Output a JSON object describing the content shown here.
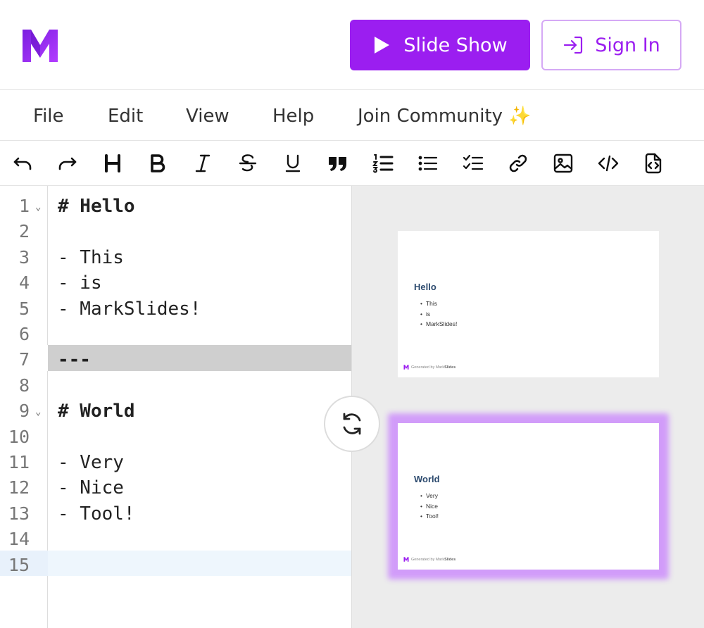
{
  "header": {
    "slideshow_label": "Slide Show",
    "signin_label": "Sign In",
    "brand_color": "#9b1ef0"
  },
  "menu": {
    "items": [
      "File",
      "Edit",
      "View",
      "Help",
      "Join Community ✨"
    ]
  },
  "toolbar": {
    "icons": [
      "undo-icon",
      "redo-icon",
      "heading-icon",
      "bold-icon",
      "italic-icon",
      "strikethrough-icon",
      "underline-icon",
      "quote-icon",
      "ordered-list-icon",
      "unordered-list-icon",
      "checklist-icon",
      "link-icon",
      "image-icon",
      "code-icon",
      "export-file-icon"
    ]
  },
  "editor": {
    "lines": [
      {
        "num": "1",
        "text": "# Hello"
      },
      {
        "num": "2",
        "text": ""
      },
      {
        "num": "3",
        "text": "- This"
      },
      {
        "num": "4",
        "text": "- is"
      },
      {
        "num": "5",
        "text": "- MarkSlides!"
      },
      {
        "num": "6",
        "text": ""
      },
      {
        "num": "7",
        "text": "---"
      },
      {
        "num": "8",
        "text": ""
      },
      {
        "num": "9",
        "text": "# World"
      },
      {
        "num": "10",
        "text": ""
      },
      {
        "num": "11",
        "text": "- Very"
      },
      {
        "num": "12",
        "text": "- Nice"
      },
      {
        "num": "13",
        "text": "- Tool!"
      },
      {
        "num": "14",
        "text": ""
      },
      {
        "num": "15",
        "text": ""
      }
    ]
  },
  "preview": {
    "slides": [
      {
        "title": "Hello",
        "bullets": [
          "This",
          "is",
          "MarkSlides!"
        ],
        "footer_prefix": "Generated by Mark",
        "footer_brand": "Slides"
      },
      {
        "title": "World",
        "bullets": [
          "Very",
          "Nice",
          "Tool!"
        ],
        "footer_prefix": "Generated by Mark",
        "footer_brand": "Slides"
      }
    ]
  }
}
